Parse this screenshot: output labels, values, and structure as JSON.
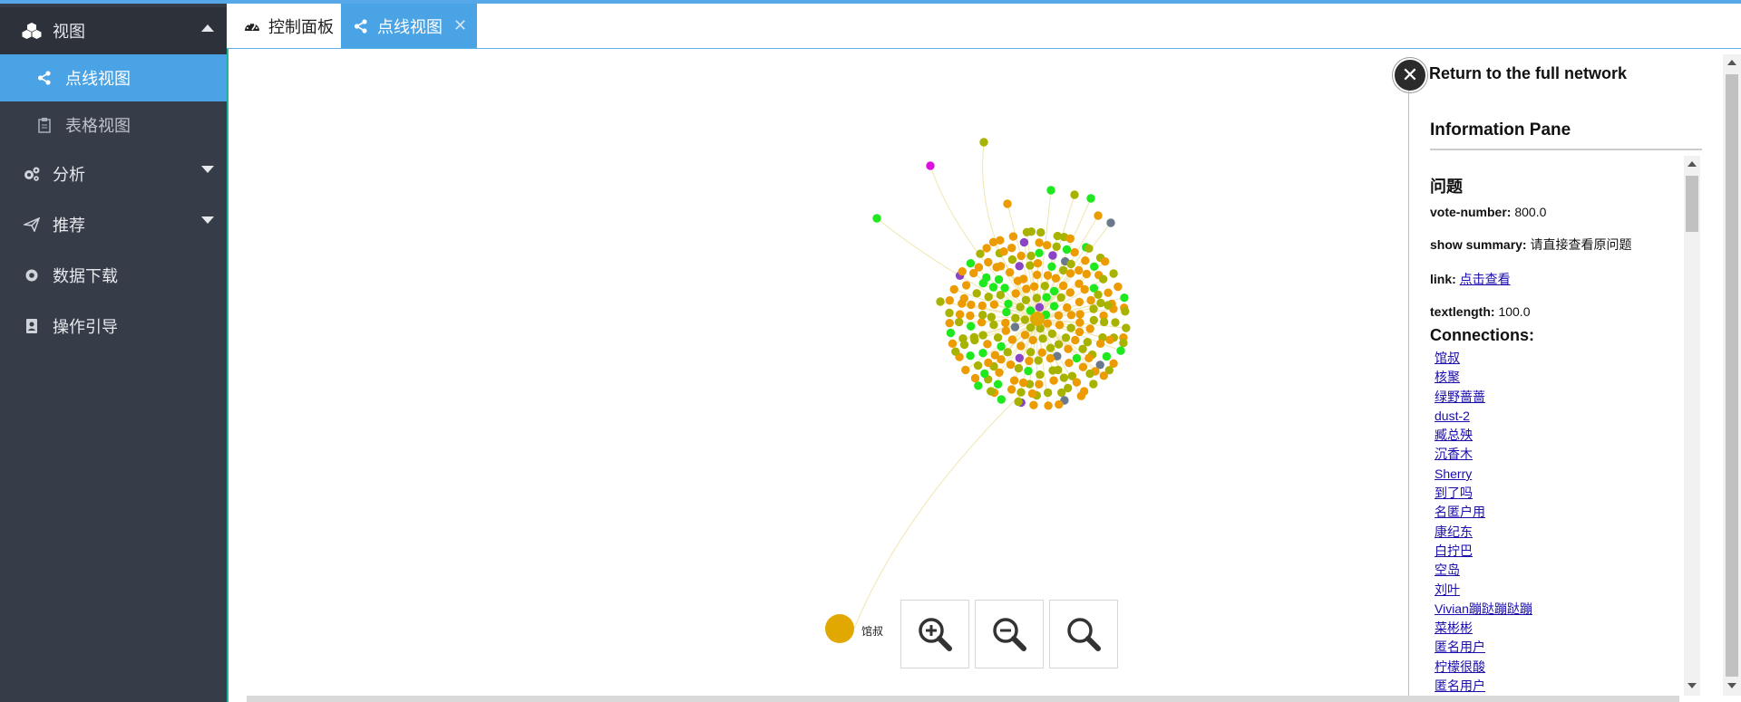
{
  "sidebar": {
    "view": {
      "label": "视图",
      "icon": "cubes-icon"
    },
    "graph": {
      "label": "点线视图",
      "icon": "share-icon"
    },
    "table": {
      "label": "表格视图",
      "icon": "clipboard-icon"
    },
    "analysis": {
      "label": "分析",
      "icon": "gears-icon"
    },
    "recommend": {
      "label": "推荐",
      "icon": "send-icon"
    },
    "download": {
      "label": "数据下载",
      "icon": "record-icon"
    },
    "guide": {
      "label": "操作引导",
      "icon": "contact-book-icon"
    }
  },
  "tabs": [
    {
      "label": "控制面板",
      "icon": "dashboard-icon",
      "active": false
    },
    {
      "label": "点线视图",
      "icon": "share-icon",
      "active": true,
      "close": "✕"
    }
  ],
  "graph": {
    "legend_label": "馆叔",
    "colors": {
      "orange": "#ec9b00",
      "olive": "#a8b300",
      "green": "#1ee81e",
      "purple": "#8a44c4",
      "slate": "#6a7a8c",
      "magenta": "#dd11dd",
      "hub": "#e0a800"
    }
  },
  "info": {
    "return_label": "Return to the full network",
    "pane_title": "Information Pane",
    "heading": "问题",
    "fields": [
      {
        "key": "vote-number:",
        "value": "800.0"
      },
      {
        "key": "show summary:",
        "value": "请直接查看原问题"
      },
      {
        "key": "link:",
        "value": "点击查看"
      },
      {
        "key": "textlength:",
        "value": "100.0"
      }
    ],
    "connections_label": "Connections:",
    "connections": [
      "馆叔",
      "核聚",
      "绿野蔷蔷",
      "dust-2",
      "臧总殃",
      "沉香木",
      "Sherry",
      "到了吗",
      "名匿户用",
      "康纪东",
      "白拧巴",
      "空岛",
      "刘叶",
      "Vivian蹦跶蹦跶蹦",
      "菜彬彬",
      "匿名用户",
      "柠檬很酸",
      "匿名用户"
    ]
  }
}
